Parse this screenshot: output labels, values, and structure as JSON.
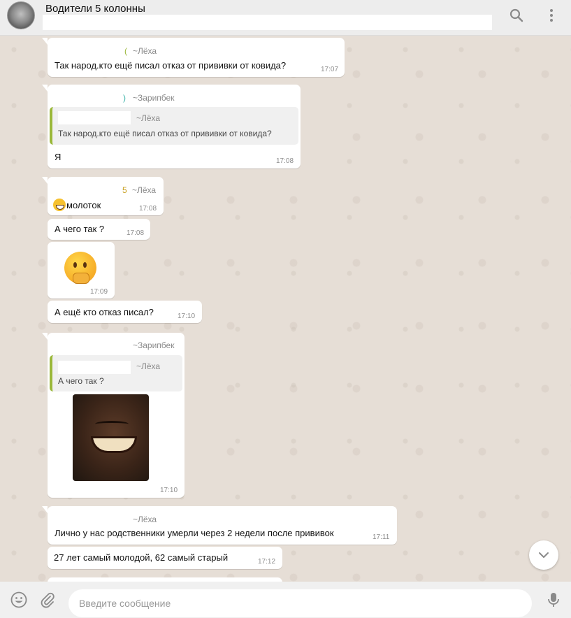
{
  "header": {
    "title": "Водители 5 колонны",
    "search_icon": "search-icon",
    "menu_icon": "more-vertical-icon"
  },
  "messages": [
    {
      "sender": "~Лёха",
      "text": "Так народ.кто ещё писал отказ от прививки от ковида?",
      "time": "17:07"
    },
    {
      "sender": "~Зарипбек",
      "quote_sender": "~Лёха",
      "quote_text": "Так народ.кто ещё писал отказ от прививки от ковида?",
      "text": "Я",
      "time": "17:08"
    },
    {
      "sender": "~Лёха",
      "text": "молоток",
      "time": "17:08"
    },
    {
      "text": "А чего так ?",
      "time": "17:08"
    },
    {
      "sticker": "thinking-face",
      "time": "17:09"
    },
    {
      "text": "А ещё кто отказ писал?",
      "time": "17:10"
    },
    {
      "sender": "~Зарипбек",
      "quote_sender": "~Лёха",
      "quote_text": "А чего так ?",
      "image": "laughing-man-photo",
      "time": "17:10"
    },
    {
      "sender": "~Лёха",
      "text": "Лично у нас родственники умерли через 2 недели после прививок",
      "time": "17:11"
    },
    {
      "text": "27 лет самый молодой, 62 самый старый",
      "time": "17:12"
    }
  ],
  "composer": {
    "placeholder": "Введите сообщение",
    "emoji_icon": "emoji-icon",
    "attach_icon": "paperclip-icon",
    "mic_icon": "microphone-icon"
  },
  "colors": {
    "accent_quote_bar": "#9ab83a",
    "chat_bg": "#e5ddd5",
    "bubble_bg": "#ffffff"
  }
}
